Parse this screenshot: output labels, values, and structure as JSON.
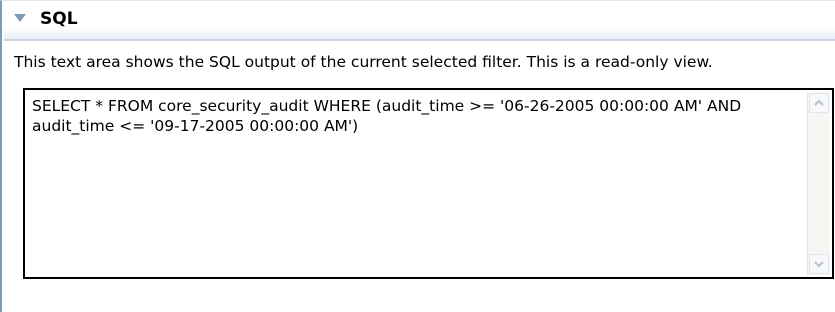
{
  "section": {
    "title": "SQL",
    "description": "This text area shows the SQL output of the current selected filter. This is a read-only view.",
    "sql_output": "SELECT * FROM core_security_audit WHERE (audit_time >= '06-26-2005 00:00:00 AM' AND audit_time <= '09-17-2005 00:00:00 AM')"
  },
  "icons": {
    "twisty": "chevron-down-icon",
    "scroll_up": "arrow-up-icon",
    "scroll_down": "arrow-down-icon"
  },
  "colors": {
    "header_border": "#c9d6e6",
    "twisty": "#7f9ab8",
    "left_border": "#7f9db9"
  }
}
